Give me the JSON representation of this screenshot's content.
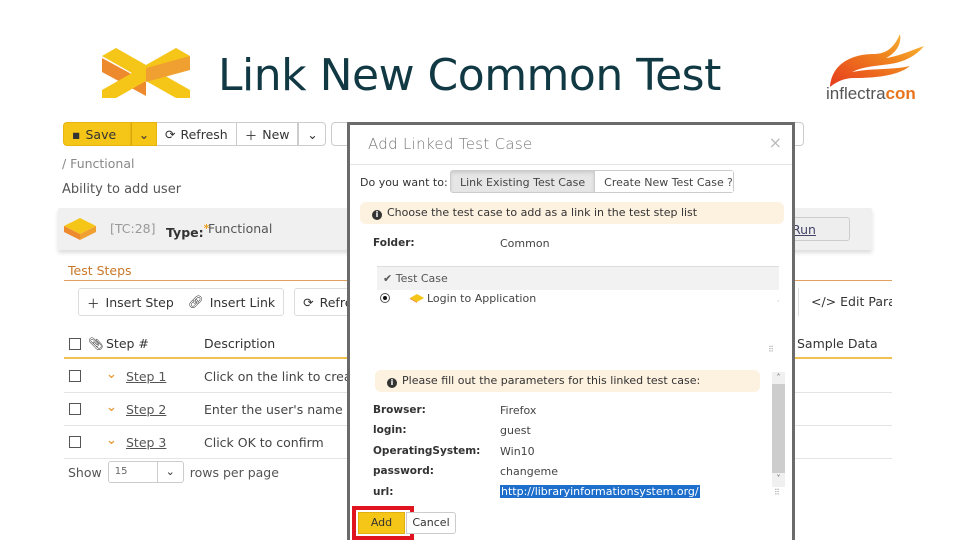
{
  "slide": {
    "title": "Link New Common Test",
    "brand_prefix": "inflectra",
    "brand_suffix": "con",
    "colors": {
      "title": "#113944",
      "accent_orange": "#e8741c",
      "accent_yellow": "#f5c518",
      "highlight_red": "#e0141e"
    }
  },
  "toolbar": {
    "save_label": "Save",
    "refresh_label": "Refresh",
    "new_label": "New"
  },
  "breadcrumb": "/ Functional",
  "test_case": {
    "name": "Ability to add user",
    "id": "[TC:28]",
    "type_label": "Type:",
    "type_required_mark": "*",
    "type_value": "Functional",
    "run_label": "Run"
  },
  "steps": {
    "section_title": "Test Steps",
    "toolbar": {
      "insert_step": "Insert Step",
      "insert_link": "Insert Link",
      "refresh": "Refre",
      "edit_params": "Edit Parar"
    },
    "columns": {
      "step": "Step #",
      "description": "Description",
      "sample_data": "Sample Data"
    },
    "rows": [
      {
        "step": "Step 1",
        "description": "Click on the link to create"
      },
      {
        "step": "Step 2",
        "description": "Enter the user's name and"
      },
      {
        "step": "Step 3",
        "description": "Click OK to confirm"
      }
    ],
    "pager": {
      "show_label": "Show",
      "page_size": "15",
      "suffix": "rows per page"
    }
  },
  "modal": {
    "title": "Add Linked Test Case",
    "close_glyph": "×",
    "mode_question": "Do you want to:",
    "mode_options": [
      "Link Existing Test Case",
      "Create New Test Case"
    ],
    "mode_selected": "Link Existing Test Case",
    "help_glyph": "?",
    "choose_alert": "Choose the test case to add as a link in the test step list",
    "folder_label": "Folder:",
    "folder_value": "Common",
    "tree_header": "Test Case",
    "tree_items": [
      {
        "label": "Login to Application",
        "selected": true
      }
    ],
    "params_alert": "Please fill out the parameters for this linked test case:",
    "params": [
      {
        "name": "Browser:",
        "value": "Firefox"
      },
      {
        "name": "login:",
        "value": "guest"
      },
      {
        "name": "OperatingSystem:",
        "value": "Win10"
      },
      {
        "name": "password:",
        "value": "changeme"
      },
      {
        "name": "url:",
        "value": "http://libraryinformationsystem.org/"
      }
    ],
    "add_label": "Add",
    "cancel_label": "Cancel"
  }
}
